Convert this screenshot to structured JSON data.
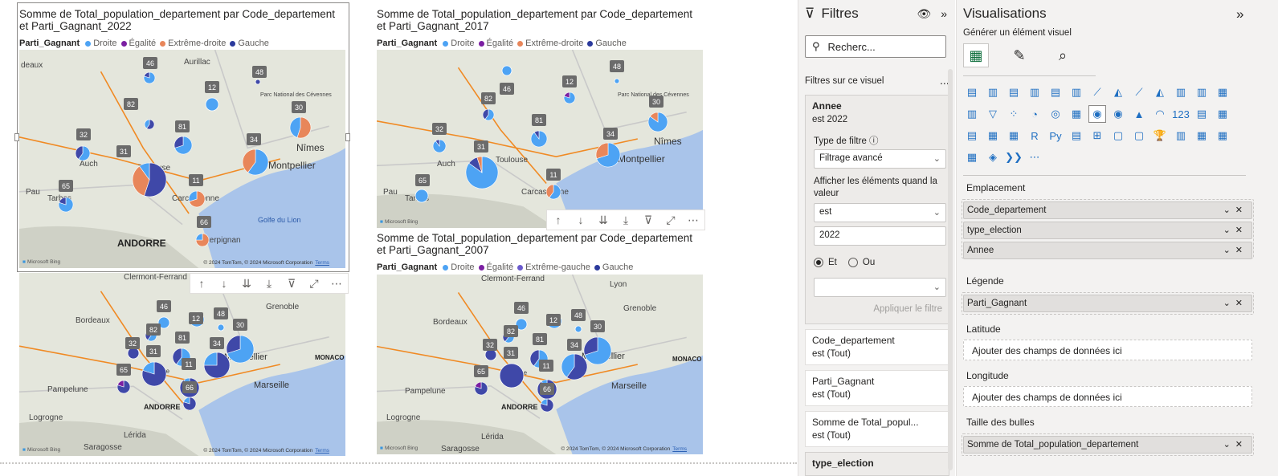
{
  "visuals": [
    {
      "title": "Somme de Total_population_departement par Code_departement\net Parti_Gagnant_2022",
      "legend_title": "Parti_Gagnant",
      "legend": [
        {
          "label": "Droite",
          "color": "#4da3f4"
        },
        {
          "label": "Égalité",
          "color": "#7b1fa2"
        },
        {
          "label": "Extrême-droite",
          "color": "#e8865a"
        },
        {
          "label": "Gauche",
          "color": "#2b3a9c"
        }
      ],
      "map_labels": [
        "Aurillac",
        "Parc National des Cévennes",
        "Auch",
        "Toulouse",
        "Montpellier",
        "Nîmes",
        "Pau",
        "Tarbes",
        "Carcassonne",
        "Perpignan",
        "Golfe du Lion",
        "ANDORRE",
        "deaux"
      ],
      "badges": [
        "46",
        "48",
        "12",
        "82",
        "30",
        "81",
        "32",
        "34",
        "31",
        "11",
        "65",
        "66"
      ],
      "credit": "© 2024 TomTom, © 2024 Microsoft Corporation",
      "terms": "Terms",
      "bing": "Microsoft Bing"
    },
    {
      "title": "Somme de Total_population_departement par Code_departement\net Parti_Gagnant_2017",
      "legend_title": "Parti_Gagnant",
      "legend": [
        {
          "label": "Droite",
          "color": "#4da3f4"
        },
        {
          "label": "Égalité",
          "color": "#7b1fa2"
        },
        {
          "label": "Extrême-droite",
          "color": "#e8865a"
        },
        {
          "label": "Gauche",
          "color": "#2b3a9c"
        }
      ],
      "map_labels": [
        "Parc National des Cévennes",
        "Auch",
        "Toulouse",
        "Montpellier",
        "Nîmes",
        "Pau",
        "Tarbes",
        "Carcassonne"
      ],
      "badges": [
        "46",
        "48",
        "12",
        "82",
        "30",
        "81",
        "32",
        "34",
        "31",
        "11",
        "65"
      ],
      "credit": "© 2024 TomTom, © 2024 Microsoft Corporation",
      "terms": "Terms",
      "bing": "Microsoft Bing"
    },
    {
      "title": "",
      "legend_title": "",
      "legend": [],
      "map_labels": [
        "Clermont-Ferrand",
        "Bordeaux",
        "Grenoble",
        "Montpellier",
        "Marseille",
        "MONACO",
        "Pampelune",
        "ANDORRE",
        "Logrogne",
        "Lérida",
        "Saragosse",
        "Toulouse"
      ],
      "badges": [
        "46",
        "48",
        "12",
        "82",
        "30",
        "81",
        "32",
        "34",
        "31",
        "11",
        "65",
        "66"
      ],
      "credit": "© 2024 TomTom, © 2024 Microsoft Corporation",
      "terms": "Terms",
      "bing": "Microsoft Bing"
    },
    {
      "title": "Somme de Total_population_departement par Code_departement\net Parti_Gagnant_2007",
      "legend_title": "Parti_Gagnant",
      "legend": [
        {
          "label": "Droite",
          "color": "#4da3f4"
        },
        {
          "label": "Égalité",
          "color": "#7b1fa2"
        },
        {
          "label": "Extrême-gauche",
          "color": "#6a5acd"
        },
        {
          "label": "Gauche",
          "color": "#2b3a9c"
        }
      ],
      "map_labels": [
        "Clermont-Ferrand",
        "Lyon",
        "Bordeaux",
        "Grenoble",
        "Montpellier",
        "Marseille",
        "MONACO",
        "Pampelune",
        "ANDORRE",
        "Logrogne",
        "Lérida",
        "Saragosse",
        "Toulouse"
      ],
      "badges": [
        "46",
        "48",
        "12",
        "82",
        "30",
        "81",
        "32",
        "34",
        "31",
        "11",
        "65",
        "66"
      ],
      "credit": "© 2024 TomTom, © 2024 Microsoft Corporation",
      "terms": "Terms",
      "bing": "Microsoft Bing"
    }
  ],
  "colors": {
    "droite": "#4da3f4",
    "gauche": "#3f48a8",
    "extreme_droite": "#e8865a",
    "egalite": "#7b1fa2",
    "extreme_gauche": "#6a5acd"
  },
  "header_icons": [
    "↑",
    "↓",
    "⇊",
    "⤓",
    "⊽",
    "⤢",
    "⋯"
  ],
  "filters": {
    "title": "Filtres",
    "search_placeholder": "Recherc...",
    "section": "Filtres sur ce visuel",
    "section_more": "...",
    "annee": {
      "title": "Annee",
      "summary": "est 2022",
      "type_label": "Type de filtre",
      "type_value": "Filtrage avancé",
      "show_label": "Afficher les éléments quand la valeur",
      "op_value": "est",
      "value": "2022",
      "radio_and": "Et",
      "radio_or": "Ou",
      "apply": "Appliquer le filtre"
    },
    "cards": [
      {
        "title": "Code_departement",
        "sub": "est (Tout)"
      },
      {
        "title": "Parti_Gagnant",
        "sub": "est (Tout)"
      },
      {
        "title": "Somme de Total_popul...",
        "sub": "est (Tout)"
      }
    ],
    "last_card": "type_election"
  },
  "viz": {
    "title": "Visualisations",
    "subtitle": "Générer un élément visuel",
    "grid_icons": [
      "▤",
      "▥",
      "▤",
      "▥",
      "▤",
      "▥",
      "⟋",
      "◭",
      "⟋",
      "◭",
      "▥",
      "▥",
      "▦",
      "▥",
      "▽",
      "⁘",
      "◔",
      "◎",
      "▦",
      "◉",
      "◉",
      "▲",
      "◠",
      "123",
      "▤",
      "▦",
      "▤",
      "▦",
      "▦",
      "R",
      "Py",
      "▤",
      "⊞",
      "▢",
      "▢",
      "🏆",
      "▥",
      "▦",
      "▦",
      "▦",
      "◈",
      "❯❯",
      "⋯"
    ],
    "wells": [
      {
        "label": "Emplacement",
        "fields": [
          "Code_departement",
          "type_election",
          "Annee"
        ]
      },
      {
        "label": "Légende",
        "fields": [
          "Parti_Gagnant"
        ]
      },
      {
        "label": "Latitude",
        "placeholder": "Ajouter des champs de données ici"
      },
      {
        "label": "Longitude",
        "placeholder": "Ajouter des champs de données ici"
      },
      {
        "label": "Taille des bulles",
        "fields": [
          "Somme de Total_population_departement"
        ]
      }
    ]
  }
}
